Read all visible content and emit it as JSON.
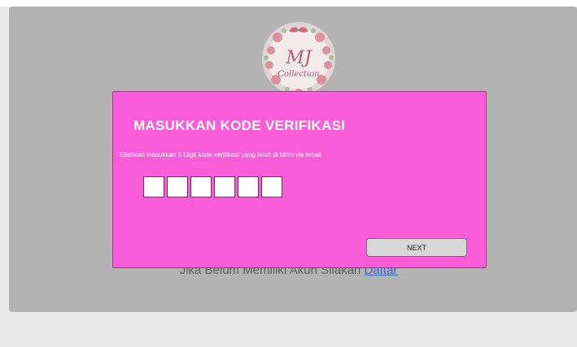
{
  "logo": {
    "line1": "MJ",
    "line2": "Collection"
  },
  "signup": {
    "text": "Jika Belum Memiliki Akun Silakan",
    "link": "Daftar"
  },
  "modal": {
    "title": "MASUKKAN KODE VERIFIKASI",
    "description": "Silahkan masukkan 6 Digit kode verifikasi yang telah di kirim via email",
    "code_values": [
      "",
      "",
      "",
      "",
      "",
      ""
    ],
    "next_label": "NEXT"
  },
  "colors": {
    "modal_bg": "#fb5cd8",
    "card_bg": "#b3b3b3",
    "page_bg": "#e9e9e9",
    "link": "#3e63b8"
  }
}
